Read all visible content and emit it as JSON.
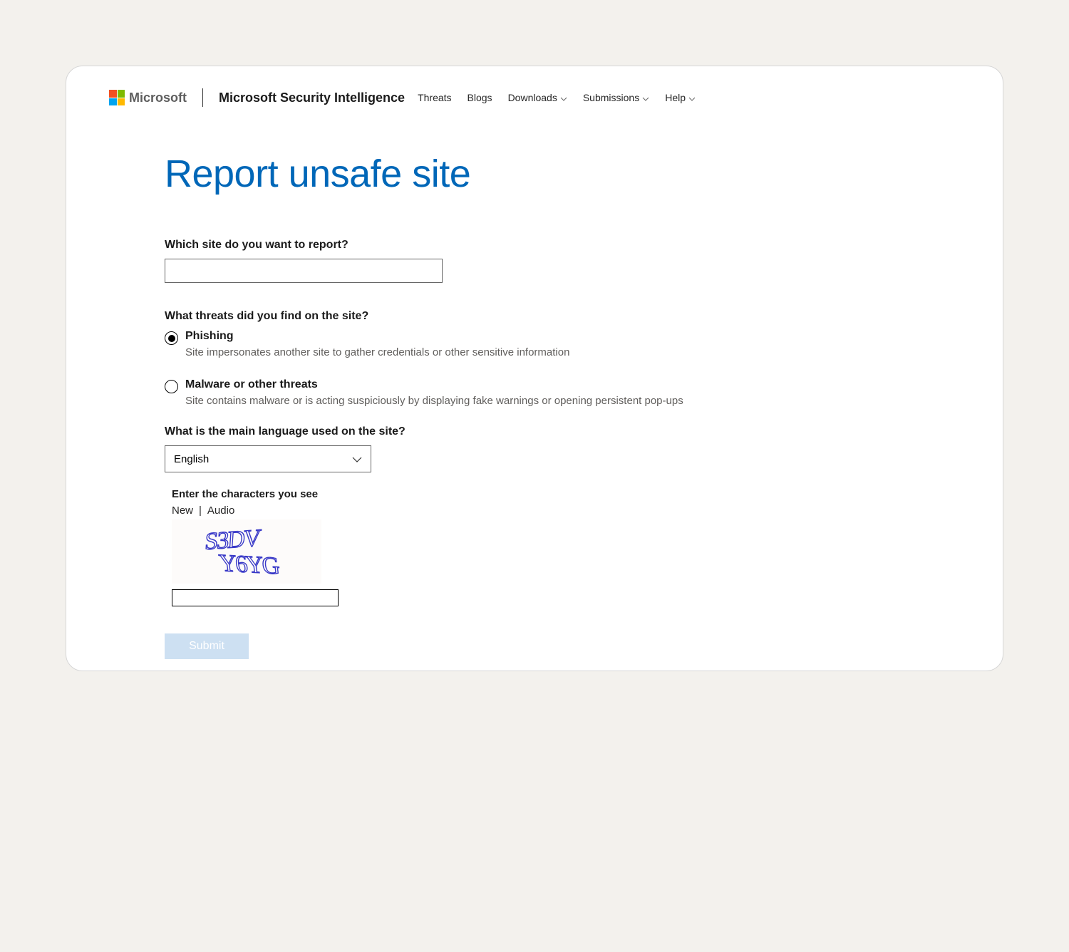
{
  "header": {
    "brand": "Microsoft",
    "product": "Microsoft Security Intelligence",
    "nav": {
      "threats": "Threats",
      "blogs": "Blogs",
      "downloads": "Downloads",
      "submissions": "Submissions",
      "help": "Help"
    }
  },
  "page": {
    "title": "Report unsafe site"
  },
  "form": {
    "site_label": "Which site do you want to report?",
    "site_value": "",
    "threats_label": "What threats did you find on the site?",
    "threats": {
      "phishing": {
        "label": "Phishing",
        "desc": "Site impersonates another site to gather credentials or other sensitive information",
        "selected": true
      },
      "malware": {
        "label": "Malware or other threats",
        "desc": "Site contains malware or is acting suspiciously by displaying fake warnings or opening persistent pop-ups",
        "selected": false
      }
    },
    "language_label": "What is the main language used on the site?",
    "language_selected": "English",
    "captcha": {
      "label": "Enter the characters you see",
      "new": "New",
      "sep": "|",
      "audio": "Audio",
      "image_text_line1": "S3DV",
      "image_text_line2": "Y6YG",
      "input_value": ""
    },
    "submit_label": "Submit"
  }
}
